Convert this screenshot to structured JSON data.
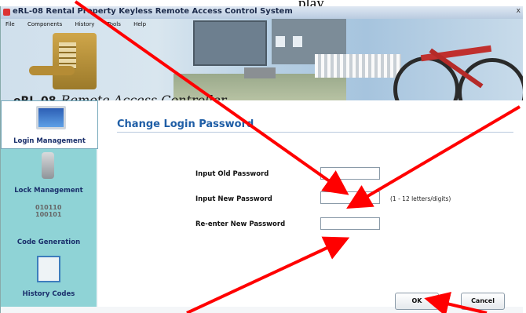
{
  "doc_text": "play",
  "window": {
    "title": "eRL-08 Rental Property Keyless Remote Access Control System",
    "close_glyph": "x"
  },
  "menu": [
    "File",
    "Components",
    "History",
    "Tools",
    "Help"
  ],
  "brand": {
    "name": "eRL-08",
    "script": "Remote Access Controller"
  },
  "sidebar": {
    "items": [
      {
        "label": "Login Management",
        "icon": "monitor-icon",
        "active": true
      },
      {
        "label": "Lock Management",
        "icon": "lock-icon",
        "active": false
      },
      {
        "label": "Code Generation",
        "icon": "keys-icon",
        "active": false
      },
      {
        "label": "History Codes",
        "icon": "history-icon",
        "active": false
      }
    ]
  },
  "keys_icon_text": "010110\n100101",
  "main": {
    "title": "Change Login Password",
    "fields": [
      {
        "label": "Input Old Password",
        "value": ""
      },
      {
        "label": "Input New Password",
        "value": "",
        "hint": "(1 - 12 letters/digits)"
      },
      {
        "label": "Re-enter New Password",
        "value": ""
      }
    ],
    "ok_label": "OK",
    "cancel_label": "Cancel"
  },
  "annotation_color": "#ff0000"
}
